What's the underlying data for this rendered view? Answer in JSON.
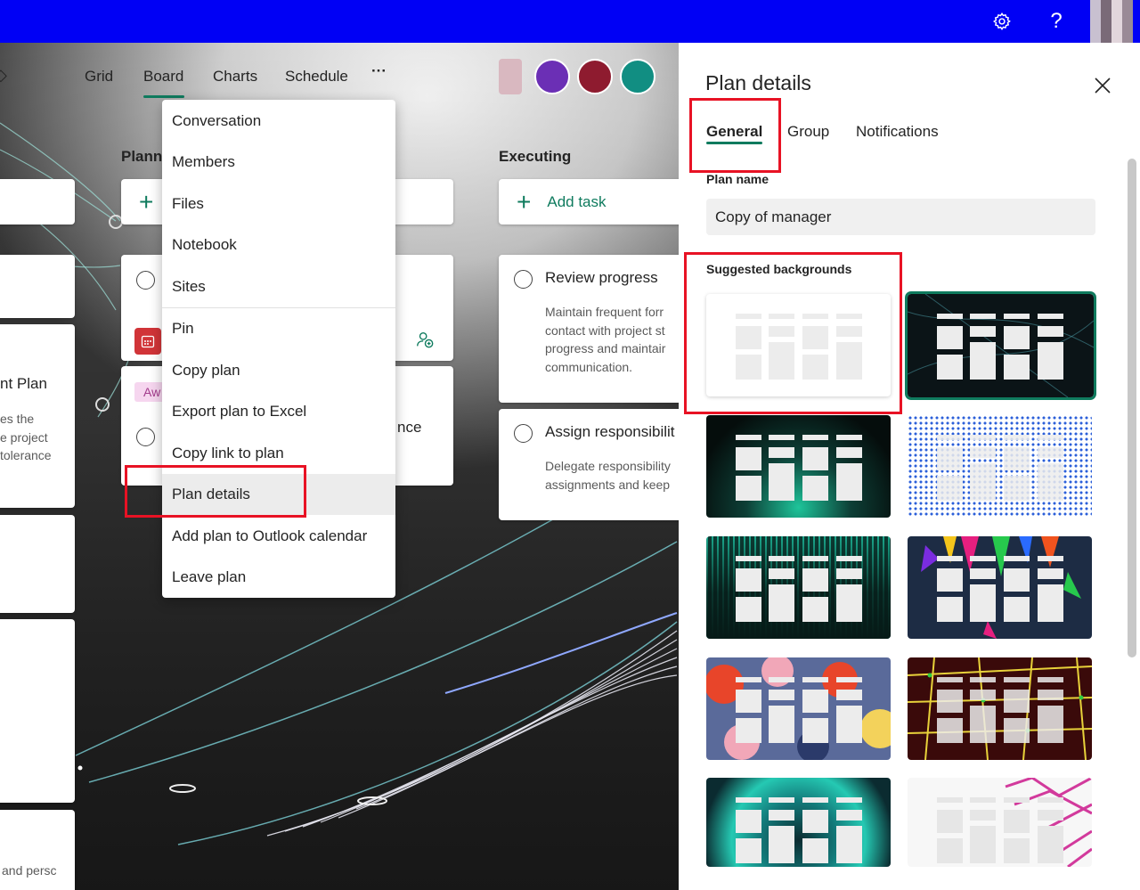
{
  "topbar": {
    "settings_icon": "gear-icon",
    "help_icon": "question-icon",
    "help_label": "?"
  },
  "board": {
    "nav": [
      "Grid",
      "Board",
      "Charts",
      "Schedule"
    ],
    "more_label": "···",
    "columns": {
      "left_fragment_title": "Plann",
      "executing_title": "Executing"
    },
    "add_task_label": "Add task",
    "left_cards": {
      "plan_title_fragment": "nt Plan",
      "desc_fragment": [
        "es the",
        "e project",
        "tolerance"
      ],
      "bottom_fragment": "and persc"
    },
    "mid_cards": {
      "badge_fragment": "Aw",
      "text_fragment": "nce"
    },
    "cards": [
      {
        "title": "Review progress",
        "desc": [
          "Maintain frequent forr",
          "contact with project st",
          "progress and maintair",
          "communication."
        ]
      },
      {
        "title": "Assign responsibilit",
        "desc": [
          "Delegate responsibility",
          "assignments and keep"
        ]
      }
    ]
  },
  "context_menu": {
    "items": [
      "Conversation",
      "Members",
      "Files",
      "Notebook",
      "Sites",
      "Pin",
      "Copy plan",
      "Export plan to Excel",
      "Copy link to plan",
      "Plan details",
      "Add plan to Outlook calendar",
      "Leave plan"
    ],
    "active_item": "Plan details"
  },
  "panel": {
    "title": "Plan details",
    "tabs": [
      "General",
      "Group",
      "Notifications"
    ],
    "selected_tab": "General",
    "plan_name_label": "Plan name",
    "plan_name_value": "Copy of manager",
    "suggested_label": "Suggested backgrounds",
    "backgrounds": [
      "Plain white",
      "Dark network",
      "Green glow",
      "Blue dots",
      "Teal bars",
      "Colorful shapes",
      "Floral",
      "Yellow grid",
      "Teal rings",
      "Pink waves"
    ],
    "selected_background": "Dark network"
  },
  "colors": {
    "topbar": "#0000f5",
    "accent": "#0f7b5e",
    "highlight_box": "#e81224"
  }
}
